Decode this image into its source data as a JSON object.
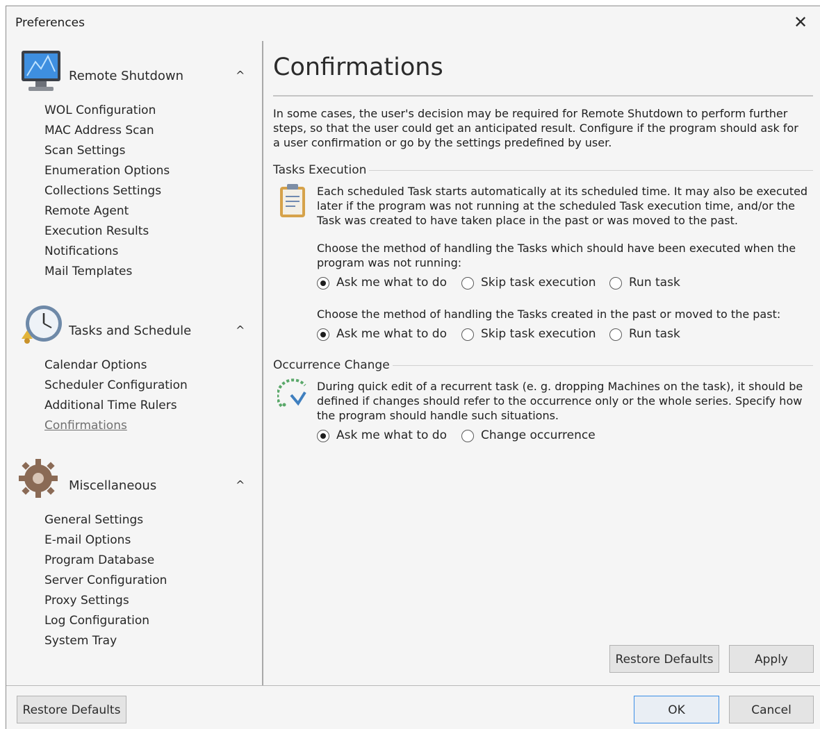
{
  "window": {
    "title": "Preferences",
    "close_glyph": "✕"
  },
  "sidebar": {
    "groups": [
      {
        "label": "Remote Shutdown",
        "icon": "monitor-icon",
        "items": [
          "WOL Configuration",
          "MAC Address Scan",
          "Scan Settings",
          "Enumeration Options",
          "Collections Settings",
          "Remote Agent",
          "Execution Results",
          "Notifications",
          "Mail Templates"
        ]
      },
      {
        "label": "Tasks and Schedule",
        "icon": "alarm-clock-icon",
        "items": [
          "Calendar Options",
          "Scheduler Configuration",
          "Additional Time Rulers",
          "Confirmations"
        ]
      },
      {
        "label": "Miscellaneous",
        "icon": "gear-icon",
        "items": [
          "General Settings",
          "E-mail Options",
          "Program Database",
          "Server Configuration",
          "Proxy Settings",
          "Log Configuration",
          "System Tray"
        ]
      }
    ],
    "chevron_glyph": "^",
    "active_item": "Confirmations"
  },
  "content": {
    "title": "Confirmations",
    "intro": "In some cases, the user's decision may be required for Remote Shutdown to perform further steps, so that the user could get an anticipated result. Configure if the program should ask for a user confirmation or go by the settings predefined by user.",
    "tasks_execution": {
      "label": "Tasks Execution",
      "description": "Each scheduled Task starts automatically at its scheduled time. It may also be executed later if the program was not running at the scheduled Task execution time, and/or the Task was created to have taken place in the past or was moved to the past.",
      "q1": "Choose the method of handling the Tasks which should have been executed when the program was not running:",
      "q1_options": [
        "Ask me what to do",
        "Skip task execution",
        "Run task"
      ],
      "q1_selected": "Ask me what to do",
      "q2": "Choose the method of handling the Tasks created in the past or moved to the past:",
      "q2_options": [
        "Ask me what to do",
        "Skip task execution",
        "Run task"
      ],
      "q2_selected": "Ask me what to do"
    },
    "occurrence_change": {
      "label": "Occurrence Change",
      "description": "During quick edit of a recurrent task (e. g. dropping Machines on the task), it should be defined if changes should refer to the occurrence only or the whole series. Specify how the program should handle such situations.",
      "options": [
        "Ask me what to do",
        "Change occurrence"
      ],
      "selected": "Ask me what to do"
    },
    "restore_defaults_label": "Restore Defaults",
    "apply_label": "Apply"
  },
  "footer": {
    "restore_defaults_label": "Restore Defaults",
    "ok_label": "OK",
    "cancel_label": "Cancel"
  },
  "colors": {
    "dialog_bg": "#f5f5f5",
    "accent_border": "#3a8ee6",
    "active_link": "#707070"
  }
}
